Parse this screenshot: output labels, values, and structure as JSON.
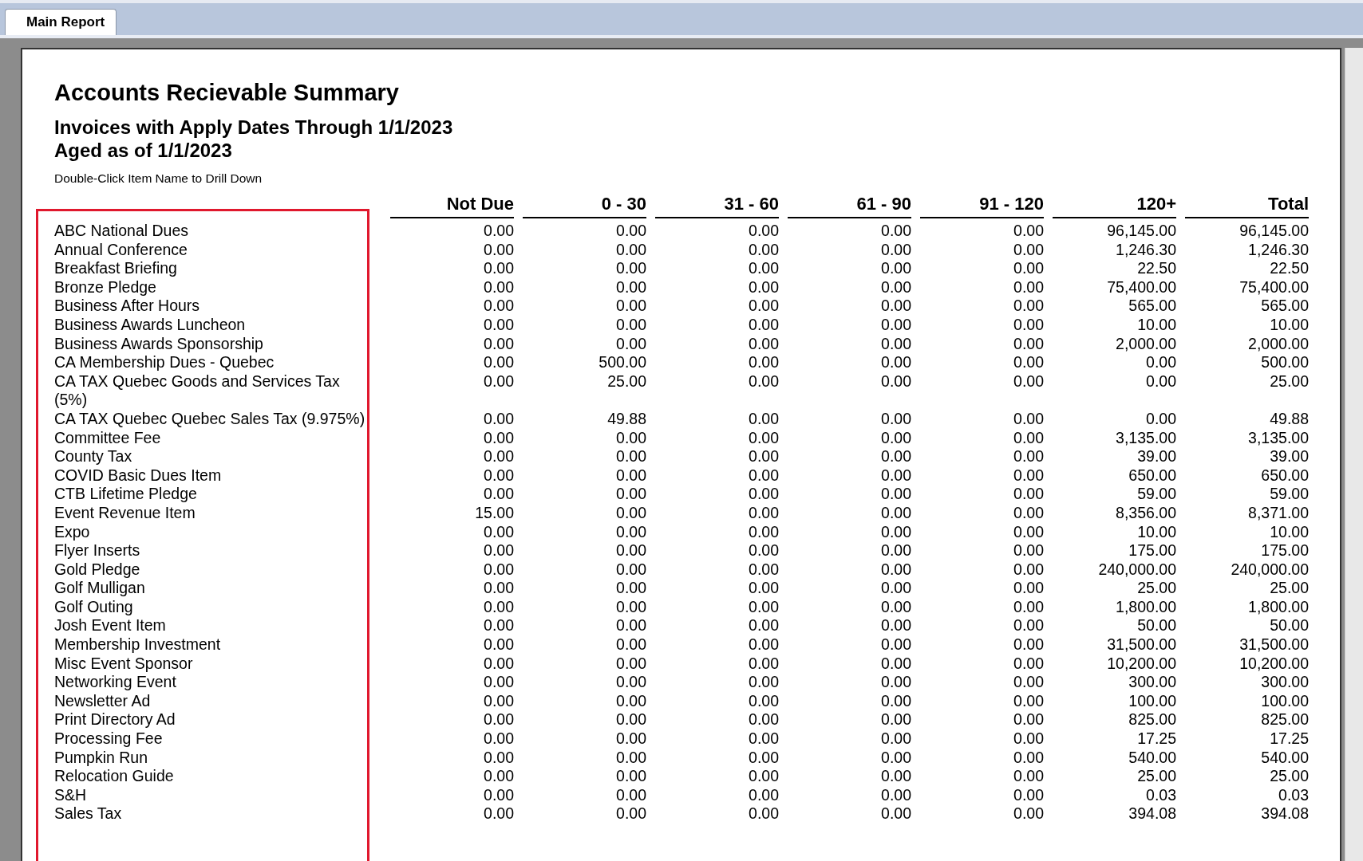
{
  "tabs": [
    {
      "label": "Main Report",
      "selected": true
    }
  ],
  "report": {
    "title": "Accounts Recievable Summary",
    "subtitle_lines": [
      "Invoices with Apply Dates Through 1/1/2023",
      "Aged as of 1/1/2023"
    ],
    "hint": "Double-Click Item Name to Drill Down",
    "columns": [
      "Not Due",
      "0 - 30",
      "31 - 60",
      "61 - 90",
      "91 - 120",
      "120+",
      "Total"
    ],
    "rows": [
      {
        "name": "ABC National Dues",
        "values": [
          "0.00",
          "0.00",
          "0.00",
          "0.00",
          "0.00",
          "96,145.00",
          "96,145.00"
        ]
      },
      {
        "name": "Annual Conference",
        "values": [
          "0.00",
          "0.00",
          "0.00",
          "0.00",
          "0.00",
          "1,246.30",
          "1,246.30"
        ]
      },
      {
        "name": "Breakfast Briefing",
        "values": [
          "0.00",
          "0.00",
          "0.00",
          "0.00",
          "0.00",
          "22.50",
          "22.50"
        ]
      },
      {
        "name": "Bronze Pledge",
        "values": [
          "0.00",
          "0.00",
          "0.00",
          "0.00",
          "0.00",
          "75,400.00",
          "75,400.00"
        ]
      },
      {
        "name": "Business After Hours",
        "values": [
          "0.00",
          "0.00",
          "0.00",
          "0.00",
          "0.00",
          "565.00",
          "565.00"
        ]
      },
      {
        "name": "Business Awards Luncheon",
        "values": [
          "0.00",
          "0.00",
          "0.00",
          "0.00",
          "0.00",
          "10.00",
          "10.00"
        ]
      },
      {
        "name": "Business Awards Sponsorship",
        "values": [
          "0.00",
          "0.00",
          "0.00",
          "0.00",
          "0.00",
          "2,000.00",
          "2,000.00"
        ]
      },
      {
        "name": "CA Membership Dues - Quebec",
        "values": [
          "0.00",
          "500.00",
          "0.00",
          "0.00",
          "0.00",
          "0.00",
          "500.00"
        ]
      },
      {
        "name": "CA TAX Quebec Goods and Services Tax (5%)",
        "values": [
          "0.00",
          "25.00",
          "0.00",
          "0.00",
          "0.00",
          "0.00",
          "25.00"
        ]
      },
      {
        "name": "CA TAX Quebec Quebec Sales Tax (9.975%)",
        "values": [
          "0.00",
          "49.88",
          "0.00",
          "0.00",
          "0.00",
          "0.00",
          "49.88"
        ]
      },
      {
        "name": "Committee Fee",
        "values": [
          "0.00",
          "0.00",
          "0.00",
          "0.00",
          "0.00",
          "3,135.00",
          "3,135.00"
        ]
      },
      {
        "name": "County Tax",
        "values": [
          "0.00",
          "0.00",
          "0.00",
          "0.00",
          "0.00",
          "39.00",
          "39.00"
        ]
      },
      {
        "name": "COVID Basic Dues Item",
        "values": [
          "0.00",
          "0.00",
          "0.00",
          "0.00",
          "0.00",
          "650.00",
          "650.00"
        ]
      },
      {
        "name": "CTB Lifetime Pledge",
        "values": [
          "0.00",
          "0.00",
          "0.00",
          "0.00",
          "0.00",
          "59.00",
          "59.00"
        ]
      },
      {
        "name": "Event Revenue Item",
        "values": [
          "15.00",
          "0.00",
          "0.00",
          "0.00",
          "0.00",
          "8,356.00",
          "8,371.00"
        ]
      },
      {
        "name": "Expo",
        "values": [
          "0.00",
          "0.00",
          "0.00",
          "0.00",
          "0.00",
          "10.00",
          "10.00"
        ]
      },
      {
        "name": "Flyer Inserts",
        "values": [
          "0.00",
          "0.00",
          "0.00",
          "0.00",
          "0.00",
          "175.00",
          "175.00"
        ]
      },
      {
        "name": "Gold Pledge",
        "values": [
          "0.00",
          "0.00",
          "0.00",
          "0.00",
          "0.00",
          "240,000.00",
          "240,000.00"
        ]
      },
      {
        "name": "Golf Mulligan",
        "values": [
          "0.00",
          "0.00",
          "0.00",
          "0.00",
          "0.00",
          "25.00",
          "25.00"
        ]
      },
      {
        "name": "Golf Outing",
        "values": [
          "0.00",
          "0.00",
          "0.00",
          "0.00",
          "0.00",
          "1,800.00",
          "1,800.00"
        ]
      },
      {
        "name": "Josh Event Item",
        "values": [
          "0.00",
          "0.00",
          "0.00",
          "0.00",
          "0.00",
          "50.00",
          "50.00"
        ]
      },
      {
        "name": "Membership Investment",
        "values": [
          "0.00",
          "0.00",
          "0.00",
          "0.00",
          "0.00",
          "31,500.00",
          "31,500.00"
        ]
      },
      {
        "name": "Misc Event Sponsor",
        "values": [
          "0.00",
          "0.00",
          "0.00",
          "0.00",
          "0.00",
          "10,200.00",
          "10,200.00"
        ]
      },
      {
        "name": "Networking Event",
        "values": [
          "0.00",
          "0.00",
          "0.00",
          "0.00",
          "0.00",
          "300.00",
          "300.00"
        ]
      },
      {
        "name": "Newsletter Ad",
        "values": [
          "0.00",
          "0.00",
          "0.00",
          "0.00",
          "0.00",
          "100.00",
          "100.00"
        ]
      },
      {
        "name": "Print Directory Ad",
        "values": [
          "0.00",
          "0.00",
          "0.00",
          "0.00",
          "0.00",
          "825.00",
          "825.00"
        ]
      },
      {
        "name": "Processing Fee",
        "values": [
          "0.00",
          "0.00",
          "0.00",
          "0.00",
          "0.00",
          "17.25",
          "17.25"
        ]
      },
      {
        "name": "Pumpkin Run",
        "values": [
          "0.00",
          "0.00",
          "0.00",
          "0.00",
          "0.00",
          "540.00",
          "540.00"
        ]
      },
      {
        "name": "Relocation Guide",
        "values": [
          "0.00",
          "0.00",
          "0.00",
          "0.00",
          "0.00",
          "25.00",
          "25.00"
        ]
      },
      {
        "name": "S&H",
        "values": [
          "0.00",
          "0.00",
          "0.00",
          "0.00",
          "0.00",
          "0.03",
          "0.03"
        ]
      },
      {
        "name": "Sales Tax",
        "values": [
          "0.00",
          "0.00",
          "0.00",
          "0.00",
          "0.00",
          "394.08",
          "394.08"
        ]
      }
    ]
  }
}
